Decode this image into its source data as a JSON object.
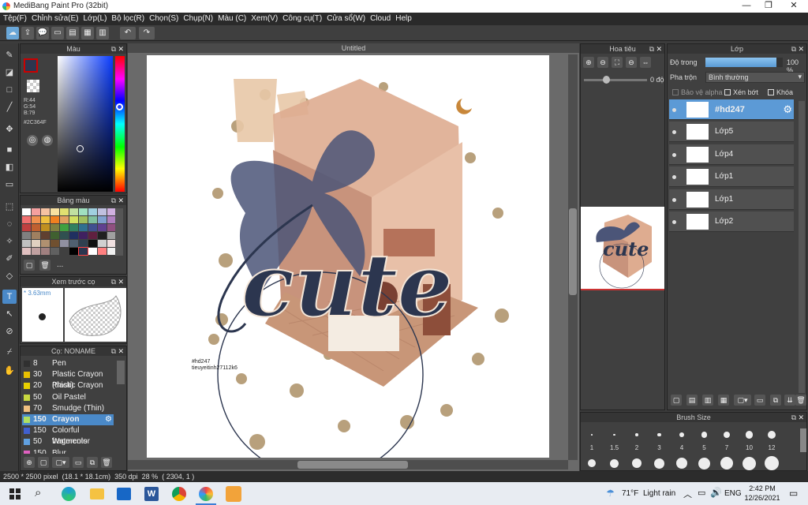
{
  "app": {
    "title": "MediBang Paint Pro (32bit)"
  },
  "window_controls": {
    "minimize": "—",
    "restore": "❐",
    "close": "✕"
  },
  "menu": [
    "Tệp(F)",
    "Chỉnh sửa(E)",
    "Lớp(L)",
    "Bộ lọc(R)",
    "Chọn(S)",
    "Chụp(N)",
    "Màu (C)",
    "Xem(V)",
    "Công cụ(T)",
    "Cửa sổ(W)",
    "Cloud",
    "Help"
  ],
  "canvas": {
    "tab_title": "Untitled",
    "signature_line1": "#hd247",
    "signature_line2": "tieuyeitinh27112k6"
  },
  "color_panel": {
    "title": "Màu",
    "r": "R:44",
    "g": "G:54",
    "b": "B:79",
    "hex": "#2C364F",
    "current_color": "#2c364f"
  },
  "palette_panel": {
    "title": "Bảng màu",
    "more": "...",
    "colors": [
      "#ffffff",
      "#f4a0a0",
      "#f6c2a2",
      "#f8e0a0",
      "#e0e070",
      "#c0e0a0",
      "#a0e0c0",
      "#a0d0e0",
      "#c0c0e0",
      "#d0b0e0",
      "#f07070",
      "#f09050",
      "#f0c040",
      "#f08020",
      "#e0a060",
      "#d0e060",
      "#a0c060",
      "#80c0a0",
      "#80a0d0",
      "#b080c0",
      "#c04040",
      "#c06030",
      "#c09020",
      "#808040",
      "#40a040",
      "#308060",
      "#307090",
      "#405090",
      "#604090",
      "#905080",
      "#808080",
      "#a08060",
      "#604030",
      "#406030",
      "#305050",
      "#203060",
      "#402060",
      "#602040",
      "#202020",
      "#a0a0a0",
      "#c0c0c0",
      "#e0d0c0",
      "#b09070",
      "#705030",
      "#9090a0",
      "#506070",
      "#304050",
      "#101010",
      "#d0d0d0",
      "#f0e0e0",
      "#e0c0c0",
      "#c0a0a0",
      "#a08080",
      "#606060",
      "#404040",
      "#000000",
      "#2c364f",
      "#ffffff",
      "#ff8080",
      "#f0f0f0"
    ]
  },
  "preview_panel": {
    "title": "Xem trước cọ",
    "size": "* 3.63mm"
  },
  "brush_panel": {
    "title": "Cọ: NONAME",
    "items": [
      {
        "size": "8",
        "name": "Pen",
        "color": "#303030"
      },
      {
        "size": "30",
        "name": "Plastic Crayon (thick)",
        "color": "#e8c000"
      },
      {
        "size": "20",
        "name": "Plastic Crayon",
        "color": "#e8d000"
      },
      {
        "size": "50",
        "name": "Oil Pastel",
        "color": "#c8d840"
      },
      {
        "size": "70",
        "name": "Smudge (Thin)",
        "color": "#f0c080"
      },
      {
        "size": "150",
        "name": "Crayon",
        "color": "#b0e060"
      },
      {
        "size": "150",
        "name": "Colorful fragments",
        "color": "#4060d0"
      },
      {
        "size": "50",
        "name": "Watercolor",
        "color": "#60a0e0"
      },
      {
        "size": "150",
        "name": "Blur",
        "color": "#e060c0"
      }
    ]
  },
  "navigator": {
    "title": "Hoa tiêu",
    "angle": "0 độ",
    "zoom_slider": 0.35
  },
  "layers_panel": {
    "title": "Lớp",
    "opacity_label": "Độ trong",
    "opacity_value": "100 %",
    "opacity": 1.0,
    "blend_label": "Pha trộn",
    "blend_value": "Bình thường",
    "protect_alpha": "Bảo vệ alpha",
    "clipping": "Xén bớt",
    "lock": "Khóa",
    "layers": [
      {
        "name": "#hd247",
        "selected": true
      },
      {
        "name": "Lớp5"
      },
      {
        "name": "Lớp4"
      },
      {
        "name": "Lớp1"
      },
      {
        "name": "Lớp1"
      },
      {
        "name": "Lớp2"
      }
    ]
  },
  "brush_size": {
    "title": "Brush Size",
    "sizes": [
      "1",
      "1.5",
      "2",
      "3",
      "4",
      "5",
      "7",
      "10",
      "12"
    ]
  },
  "status": {
    "dims": "2500 * 2500 pixel",
    "physical": "(18.1 * 18.1cm)",
    "dpi": "350 dpi",
    "zoom": "28 %",
    "coords": "( 2304, 1 )"
  },
  "taskbar": {
    "temp": "71°F",
    "weather": "Light rain",
    "lang": "ENG",
    "time": "2:42 PM",
    "date": "12/26/2021"
  }
}
